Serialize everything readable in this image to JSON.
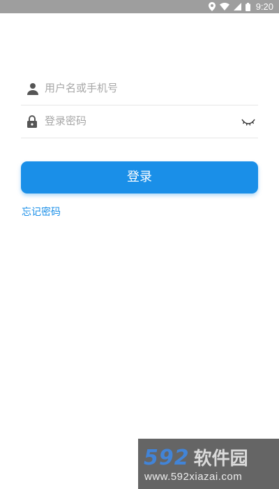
{
  "status_bar": {
    "time": "9:20",
    "icons": [
      "location-icon",
      "wifi-icon",
      "signal-icon",
      "battery-icon"
    ]
  },
  "login_form": {
    "username_placeholder": "用户名或手机号",
    "password_placeholder": "登录密码",
    "login_button_label": "登录",
    "forgot_password_label": "忘记密码",
    "icons": [
      "user-icon",
      "lock-icon",
      "eye-closed-icon"
    ]
  },
  "watermark": {
    "number": "592",
    "brand": "软件园",
    "url": "www.592xiazai.com"
  },
  "colors": {
    "accent": "#1a8fe8",
    "status_bar": "#9e9e9e",
    "placeholder": "#a7a7a7",
    "divider": "#e6e6e6"
  }
}
